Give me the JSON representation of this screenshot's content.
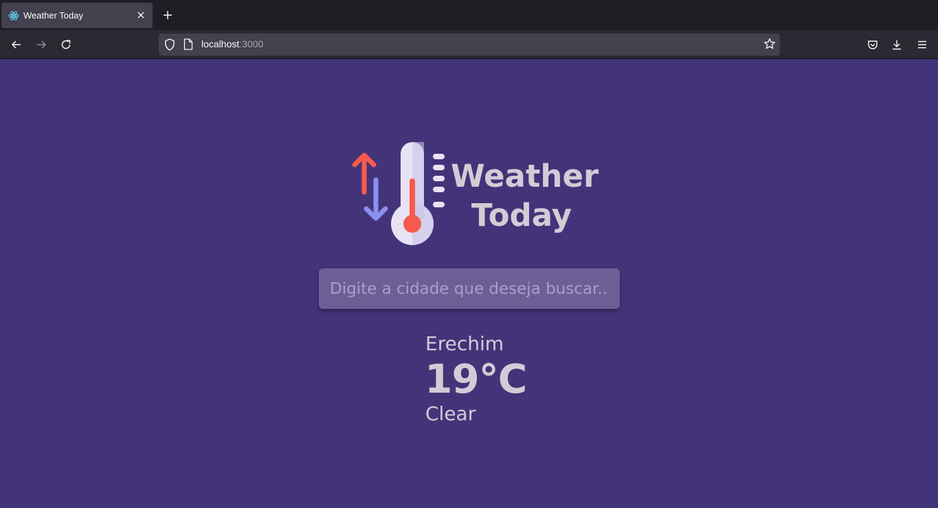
{
  "browser": {
    "tab_title": "Weather Today",
    "url_host": "localhost",
    "url_port": ":3000",
    "icons": [
      "react-favicon-icon",
      "close-icon",
      "plus-icon",
      "back-icon",
      "forward-icon",
      "reload-icon",
      "shield-icon",
      "page-icon",
      "star-icon",
      "pocket-icon",
      "download-icon",
      "menu-icon"
    ]
  },
  "app": {
    "logo_line1": "Weather",
    "logo_line2": "Today",
    "search_placeholder": "Digite a cidade que deseja buscar...",
    "city": "Erechim",
    "temperature": "19°C",
    "condition": "Clear",
    "colors": {
      "background": "#43347a",
      "text": "#d3ccd6",
      "search_bg": "#6d5f96",
      "arrow_up": "#f65b4e",
      "arrow_down": "#8b8ff0"
    }
  }
}
